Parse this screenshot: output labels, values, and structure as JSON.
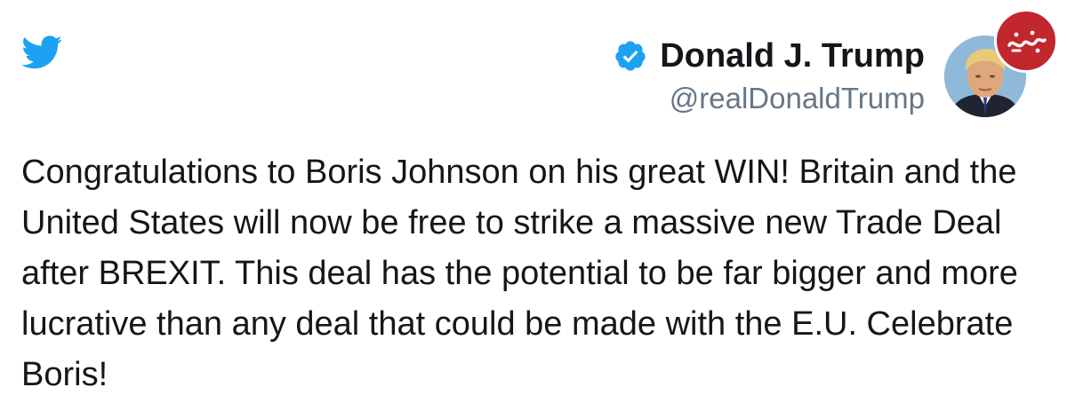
{
  "tweet": {
    "author": {
      "display_name": "Donald J. Trump",
      "handle": "@realDonaldTrump",
      "verified": true
    },
    "text": "Congratulations to Boris Johnson on his great WIN! Britain and the United States will now be free to strike a massive new Trade Deal after BREXIT. This deal has the potential to be far bigger and more lucrative than any deal that could be made with the E.U. Celebrate Boris!"
  },
  "icons": {
    "logo": "twitter-bird-icon",
    "verified": "verified-badge-icon",
    "watermark": "site-watermark-logo"
  },
  "colors": {
    "twitter_blue": "#1da1f2",
    "text_primary": "#14171a",
    "text_secondary": "#657786",
    "watermark_red": "#c1272d"
  }
}
